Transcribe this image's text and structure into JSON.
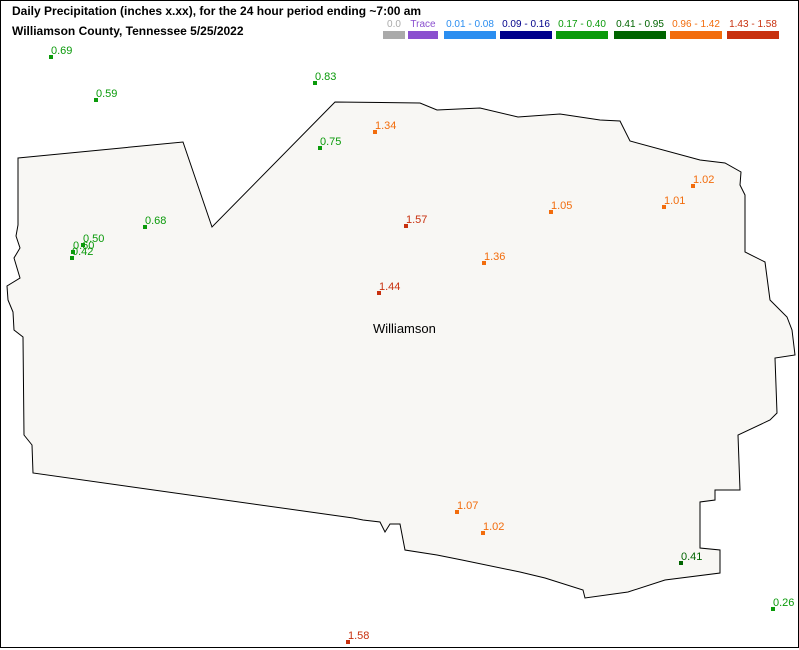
{
  "header": {
    "title": "Daily Precipitation (inches  x.xx),  for the 24 hour period ending ~7:00 am",
    "subtitle": "Williamson County, Tennessee  5/25/2022"
  },
  "legend": [
    {
      "label": "0.0",
      "color": "#aaaaaa"
    },
    {
      "label": "Trace",
      "color": "#8a4fcf"
    },
    {
      "label": "0.01 - 0.08",
      "color": "#2b8ef0"
    },
    {
      "label": "0.09 - 0.16",
      "color": "#00008b"
    },
    {
      "label": "0.17 - 0.40",
      "color": "#0a9a0a"
    },
    {
      "label": "0.41 - 0.95",
      "color": "#006400"
    },
    {
      "label": "0.96 - 1.42",
      "color": "#f26c0c"
    },
    {
      "label": "1.43 - 1.58",
      "color": "#c8300e"
    }
  ],
  "map": {
    "county_name": "Williamson",
    "county_fill": "#f8f7f4",
    "stations": [
      {
        "value": "0.69",
        "color": "#0a9a0a"
      },
      {
        "value": "0.59",
        "color": "#0a9a0a"
      },
      {
        "value": "0.83",
        "color": "#0a9a0a"
      },
      {
        "value": "0.75",
        "color": "#0a9a0a"
      },
      {
        "value": "1.34",
        "color": "#f26c0c"
      },
      {
        "value": "0.68",
        "color": "#0a9a0a"
      },
      {
        "value": "0.50",
        "color": "#0a9a0a"
      },
      {
        "value": "0.60",
        "color": "#0a9a0a"
      },
      {
        "value": "0.42",
        "color": "#0a9a0a"
      },
      {
        "value": "1.57",
        "color": "#c8300e"
      },
      {
        "value": "1.05",
        "color": "#f26c0c"
      },
      {
        "value": "1.02",
        "color": "#f26c0c"
      },
      {
        "value": "1.01",
        "color": "#f26c0c"
      },
      {
        "value": "1.36",
        "color": "#f26c0c"
      },
      {
        "value": "1.44",
        "color": "#c8300e"
      },
      {
        "value": "1.07",
        "color": "#f26c0c"
      },
      {
        "value": "1.02",
        "color": "#f26c0c"
      },
      {
        "value": "0.41",
        "color": "#006400"
      },
      {
        "value": "0.26",
        "color": "#0a9a0a"
      },
      {
        "value": "1.58",
        "color": "#c8300e"
      }
    ]
  }
}
